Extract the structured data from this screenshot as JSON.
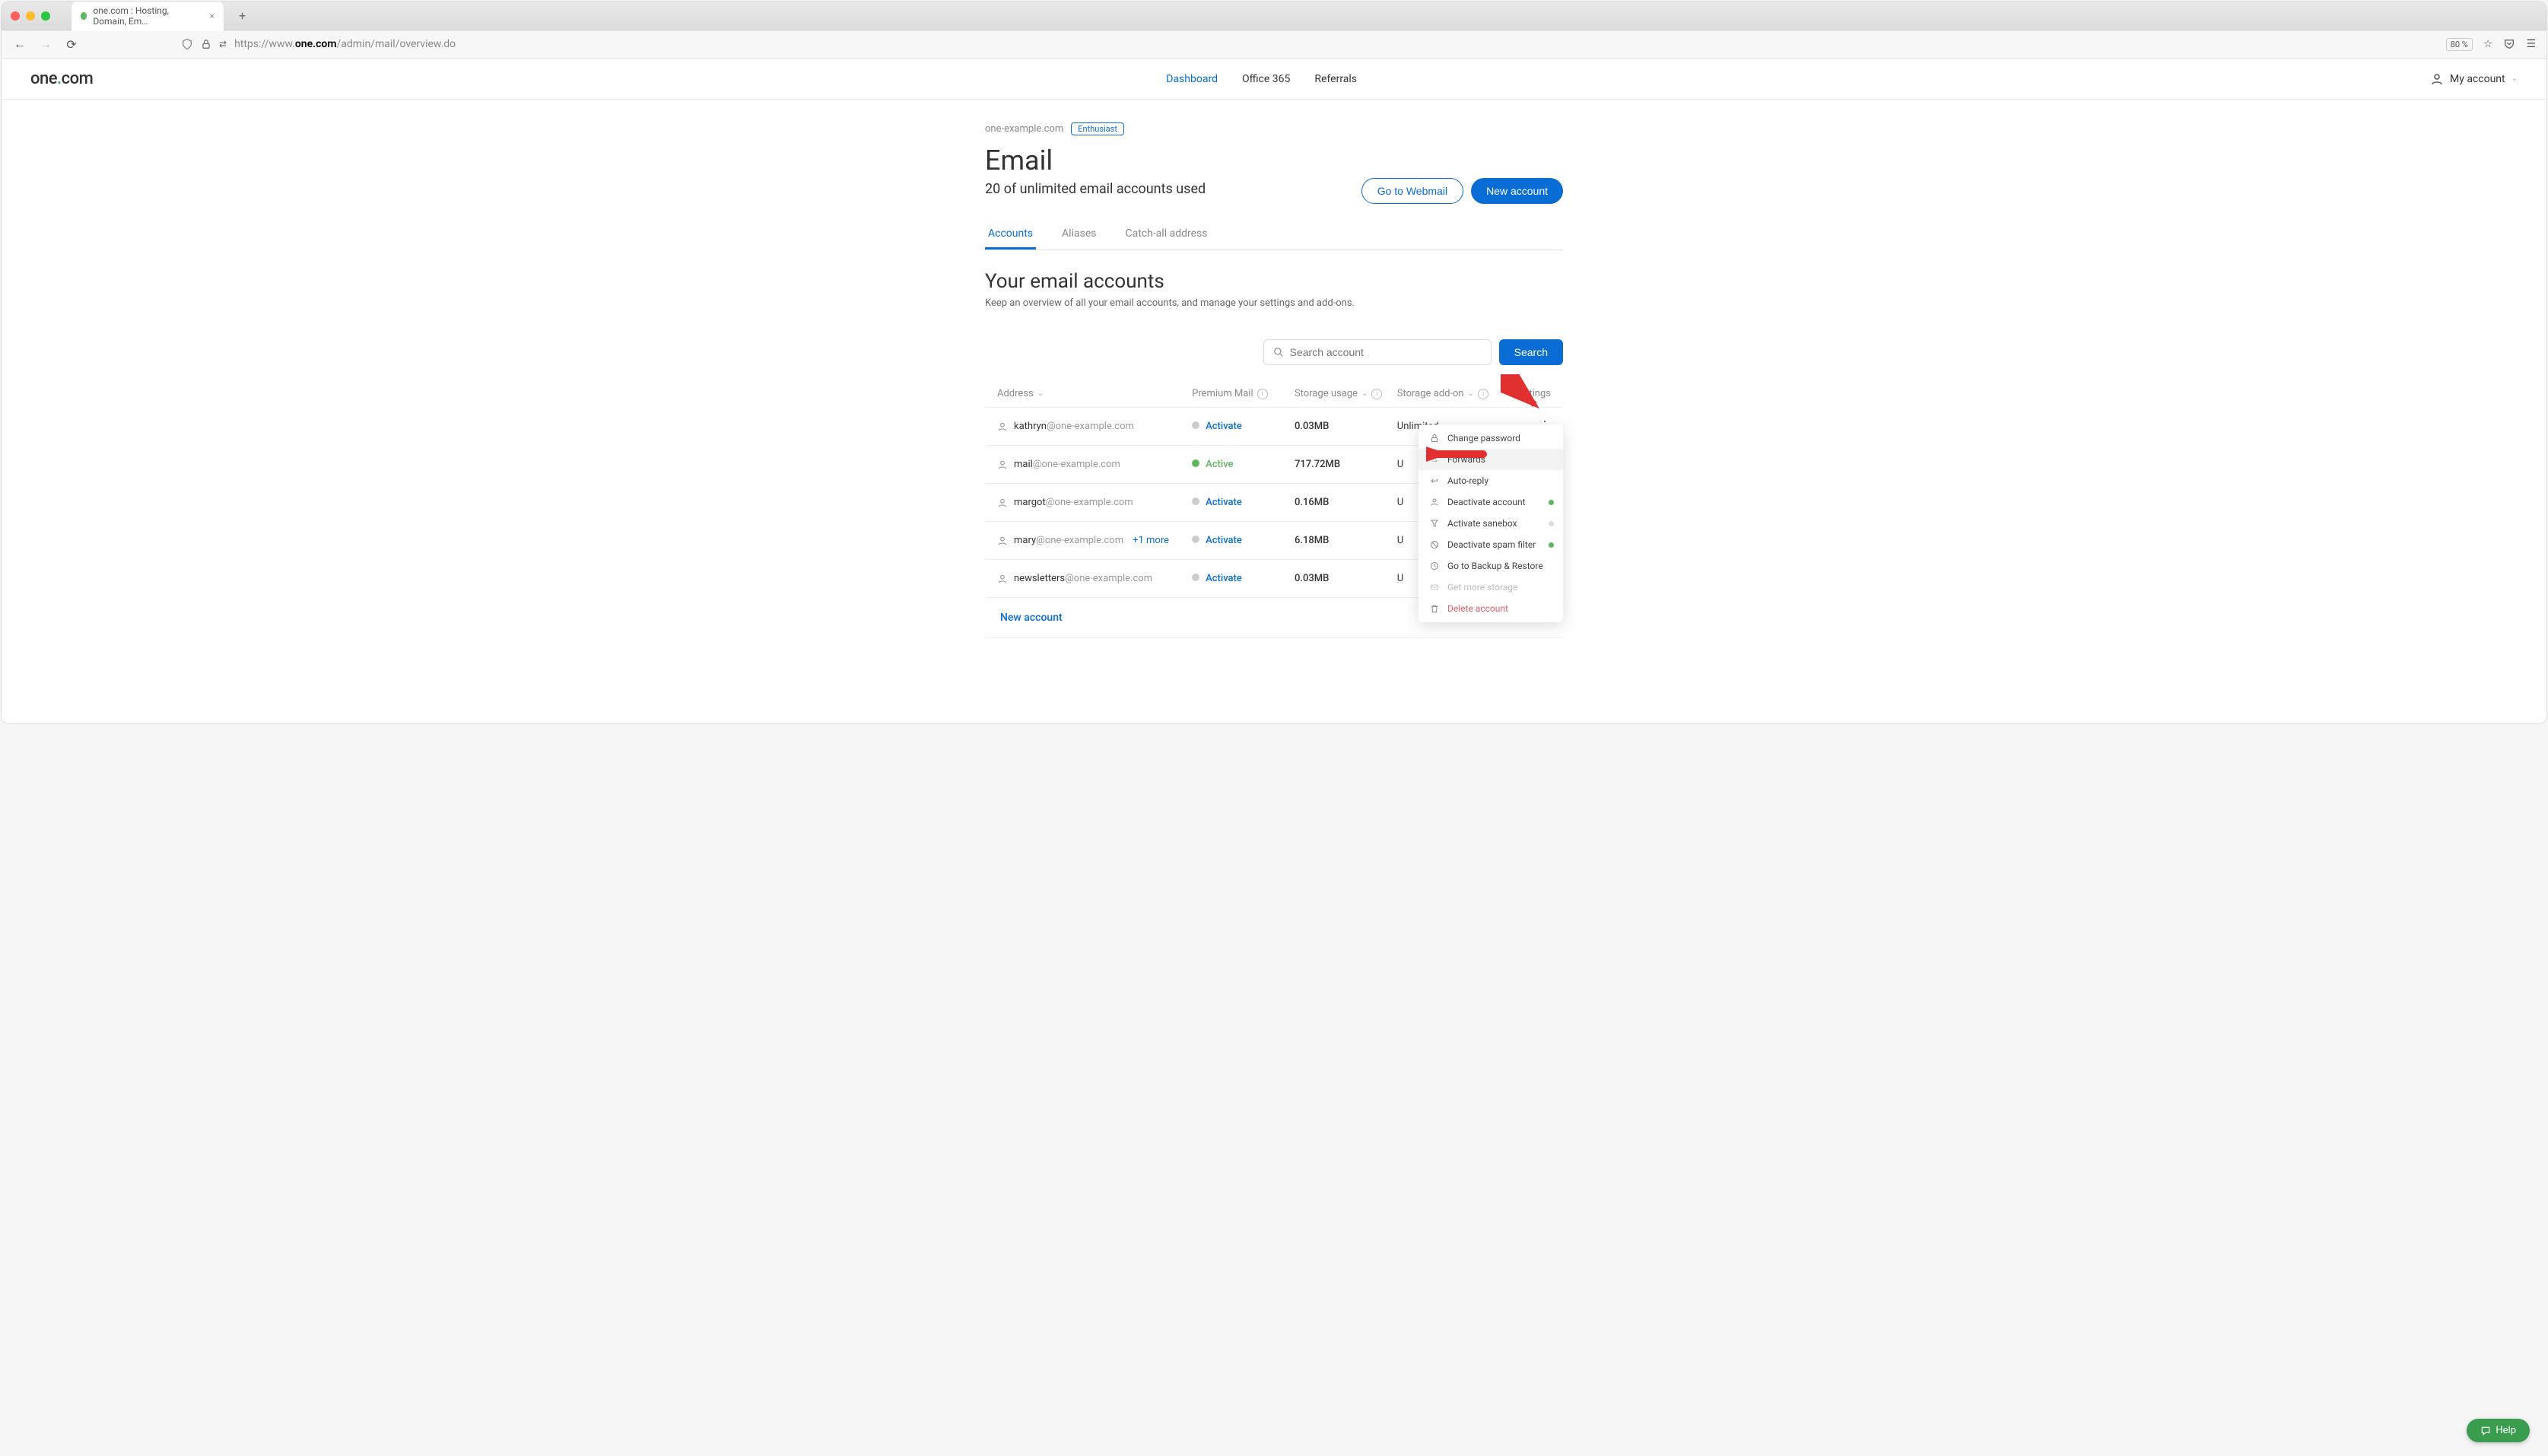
{
  "browser": {
    "tab_title": "one.com : Hosting, Domain, Em…",
    "url_prefix": "https://www.",
    "url_bold": "one.com",
    "url_suffix": "/admin/mail/overview.do",
    "zoom": "80 %"
  },
  "header": {
    "logo_pre": "one",
    "logo_dot": ".",
    "logo_post": "com",
    "nav": {
      "dashboard": "Dashboard",
      "office365": "Office 365",
      "referrals": "Referrals"
    },
    "account": "My account"
  },
  "page": {
    "domain": "one-example.com",
    "badge": "Enthusiast",
    "title": "Email",
    "subtitle": "20 of unlimited email accounts used",
    "go_webmail": "Go to Webmail",
    "new_account": "New account"
  },
  "tabs": {
    "accounts": "Accounts",
    "aliases": "Aliases",
    "catchall": "Catch-all address"
  },
  "section": {
    "title": "Your email accounts",
    "desc": "Keep an overview of all your email accounts, and manage your settings and add-ons."
  },
  "search": {
    "placeholder": "Search account",
    "button": "Search"
  },
  "columns": {
    "address": "Address",
    "premium": "Premium Mail",
    "storage": "Storage usage",
    "addon": "Storage add-on",
    "settings": "Settings"
  },
  "rows": [
    {
      "local": "kathryn",
      "domain": "@one-example.com",
      "status": "Activate",
      "active": false,
      "usage": "0.03MB",
      "addon": "Unlimited"
    },
    {
      "local": "mail",
      "domain": "@one-example.com",
      "status": "Active",
      "active": true,
      "usage": "717.72MB",
      "addon": "U"
    },
    {
      "local": "margot",
      "domain": "@one-example.com",
      "status": "Activate",
      "active": false,
      "usage": "0.16MB",
      "addon": "U"
    },
    {
      "local": "mary",
      "domain": "@one-example.com",
      "more": "+1 more",
      "status": "Activate",
      "active": false,
      "usage": "6.18MB",
      "addon": "U"
    },
    {
      "local": "newsletters",
      "domain": "@one-example.com",
      "status": "Activate",
      "active": false,
      "usage": "0.03MB",
      "addon": "U"
    }
  ],
  "footer_link": "New account",
  "dropdown": {
    "change_password": "Change password",
    "forwards": "Forwards",
    "auto_reply": "Auto-reply",
    "deactivate_account": "Deactivate account",
    "activate_sanebox": "Activate sanebox",
    "deactivate_spam": "Deactivate spam filter",
    "backup": "Go to Backup & Restore",
    "get_storage": "Get more storage",
    "delete": "Delete account"
  },
  "help": "Help"
}
